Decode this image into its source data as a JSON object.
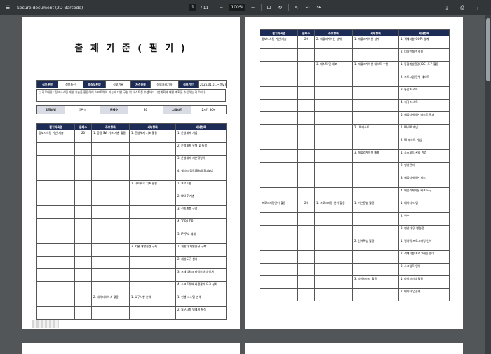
{
  "toolbar": {
    "title": "Secure document (2D Barcode)",
    "page_current": "1",
    "page_total": "/ 11",
    "zoom": "100%"
  },
  "page1": {
    "title": "출 제 기 준 ( 필 기 )",
    "info": {
      "l1": "직무분야",
      "v1": "정보통신",
      "l2": "중직무분야",
      "v2": "정보기술",
      "l3": "자격종목",
      "v3": "정보처리기사",
      "l4": "적용기간",
      "v4": "2025.01.01.~2027.12.31."
    },
    "note": "○ 직무내용 : 정보시스템 개발 기술을 활용하여 소프트웨어 기능에 대한 구현 및 테스트를 수행하고 시험계획에 대한 계획을 수립하는 직무이다.",
    "exam": {
      "l1": "검정방법",
      "v1": "객관식",
      "l2": "문제수",
      "v2": "80",
      "l3": "시험시간",
      "v3": "2시간 30분"
    },
    "headers": [
      "필기과목명",
      "문제수",
      "주요항목",
      "세부항목",
      "세세항목"
    ],
    "rows": [
      [
        "정보시스템 기반 기술",
        "20",
        "1. 응용 SW 기초 기술 활용",
        "1. 운영체제 기초 활용",
        "1. 운영체제 개념"
      ],
      [
        "",
        "",
        "",
        "",
        "2. 운영체제 유형 및 특성"
      ],
      [
        "",
        "",
        "",
        "",
        "3. 운영체제 기본명령어"
      ],
      [
        "",
        "",
        "",
        "",
        "4. 쉘 스크립트(Shell Script)"
      ],
      [
        "",
        "",
        "",
        "2. 네트워크 기초 활용",
        "1. 프로토콜"
      ],
      [
        "",
        "",
        "",
        "",
        "2. OSI 7 계층"
      ],
      [
        "",
        "",
        "",
        "",
        "3. 전송계층 구성"
      ],
      [
        "",
        "",
        "",
        "",
        "4. TCP/UDP"
      ],
      [
        "",
        "",
        "",
        "",
        "5. IP 주소 체계"
      ],
      [
        "",
        "",
        "",
        "3. 기본 개발환경 구축",
        "1. 개발자 개발환경 구축"
      ],
      [
        "",
        "",
        "",
        "",
        "2. 개발도구 설치"
      ],
      [
        "",
        "",
        "",
        "",
        "3. 프레임워크 라이브러리 설치"
      ],
      [
        "",
        "",
        "",
        "",
        "4. 소프트웨어 버전관리 도구 설치"
      ],
      [
        "",
        "",
        "2. 데이터베이스 활용",
        "1. 요구사항 분석",
        "1. 현행 시스템 분석"
      ],
      [
        "",
        "",
        "",
        "",
        "2. 요구사항 명세서 분석"
      ]
    ]
  },
  "page2": {
    "headers": [
      "필기과목명",
      "문제수",
      "주요항목",
      "세부항목",
      "세세항목"
    ],
    "rows": [
      [
        "정보시스템 기반 기술",
        "20",
        "2. 애플리케이션 설계",
        "1. 애플리케이션 설계",
        "1. 객체지향(OOP) 설계"
      ],
      [
        "",
        "",
        "",
        "",
        "2. 디자인패턴 적용"
      ],
      [
        "",
        "",
        "3. 테스트 및 배포",
        "1. 애플리케이션 테스트 수행",
        "1. 통합개발환경(IDE) 도구 활용"
      ],
      [
        "",
        "",
        "",
        "",
        "2. 프로그램 단위 테스트"
      ],
      [
        "",
        "",
        "",
        "",
        "3. 통합 테스트"
      ],
      [
        "",
        "",
        "",
        "",
        "4. 회귀 테스트"
      ],
      [
        "",
        "",
        "",
        "",
        "5. 애플리케이션 테스트 결과"
      ],
      [
        "",
        "",
        "",
        "2. UI 테스트",
        "1. UI/UX 개념"
      ],
      [
        "",
        "",
        "",
        "",
        "2. UI 테스트 기법"
      ],
      [
        "",
        "",
        "",
        "3. 애플리케이션 배포",
        "1. 소스코드 관리 기법"
      ],
      [
        "",
        "",
        "",
        "",
        "2. 형상관리"
      ],
      [
        "",
        "",
        "",
        "",
        "3. 애플리케이션 빌드"
      ],
      [
        "",
        "",
        "",
        "",
        "4. 애플리케이션 배포 도구"
      ],
      [
        "프로그래밍언어 활용",
        "20",
        "1. 프로그래밍 언어 활용",
        "1. 기본문법 활용",
        "1. 데이터 타입"
      ],
      [
        "",
        "",
        "",
        "",
        "2. 변수"
      ],
      [
        "",
        "",
        "",
        "",
        "3. 연산자 및 명령문"
      ],
      [
        "",
        "",
        "",
        "2. 언어특성 활용",
        "1. 절차적 프로그래밍 언어"
      ],
      [
        "",
        "",
        "",
        "",
        "2. 객체지향 프로그래밍 언어"
      ],
      [
        "",
        "",
        "",
        "",
        "3. 스크립트 언어"
      ],
      [
        "",
        "",
        "",
        "3. 라이브러리 활용",
        "1. 라이브러리 활용"
      ],
      [
        "",
        "",
        "",
        "",
        "2. 데이터 입출력"
      ]
    ]
  }
}
